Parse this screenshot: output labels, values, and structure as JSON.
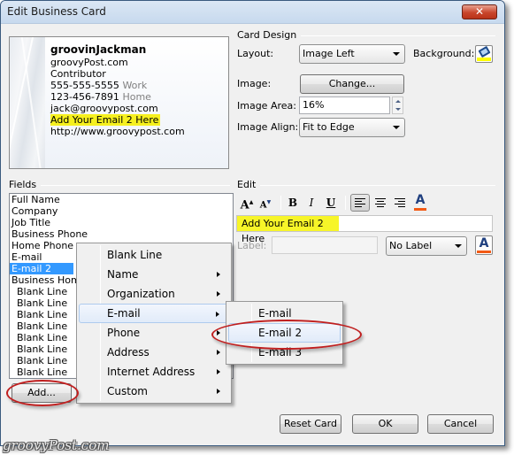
{
  "window": {
    "title": "Edit Business Card",
    "close_glyph": "✕"
  },
  "card_preview": {
    "name": "groovinJackman",
    "company": "groovyPost.com",
    "job_title": "Contributor",
    "work_phone": "555-555-5555",
    "work_label": "Work",
    "home_phone": "123-456-7891",
    "home_label": "Home",
    "email": "jack@groovypost.com",
    "email2": "Add Your Email 2 Here",
    "web": "http://www.groovypost.com"
  },
  "card_design": {
    "header": "Card Design",
    "layout_label": "Layout:",
    "layout_value": "Image Left",
    "background_label": "Background:",
    "image_label": "Image:",
    "change_button": "Change...",
    "image_area_label": "Image Area:",
    "image_area_value": "16%",
    "image_align_label": "Image Align:",
    "image_align_value": "Fit to Edge"
  },
  "fields": {
    "header": "Fields",
    "items": [
      {
        "label": "Full Name",
        "indent": false,
        "selected": false
      },
      {
        "label": "Company",
        "indent": false,
        "selected": false
      },
      {
        "label": "Job Title",
        "indent": false,
        "selected": false
      },
      {
        "label": "Business Phone",
        "indent": false,
        "selected": false
      },
      {
        "label": "Home Phone",
        "indent": false,
        "selected": false
      },
      {
        "label": "E-mail",
        "indent": false,
        "selected": false
      },
      {
        "label": "E-mail 2",
        "indent": false,
        "selected": true
      },
      {
        "label": "Business Home",
        "indent": false,
        "selected": false
      },
      {
        "label": "Blank Line",
        "indent": true,
        "selected": false
      },
      {
        "label": "Blank Line",
        "indent": true,
        "selected": false
      },
      {
        "label": "Blank Line",
        "indent": true,
        "selected": false
      },
      {
        "label": "Blank Line",
        "indent": true,
        "selected": false
      },
      {
        "label": "Blank Line",
        "indent": true,
        "selected": false
      },
      {
        "label": "Blank Line",
        "indent": true,
        "selected": false
      },
      {
        "label": "Blank Line",
        "indent": true,
        "selected": false
      },
      {
        "label": "Blank Line",
        "indent": true,
        "selected": false
      }
    ],
    "add_button": "Add..."
  },
  "edit": {
    "header": "Edit",
    "toolbar": {
      "grow_font": "A",
      "shrink_font": "A",
      "bold": "B",
      "italic": "I",
      "underline": "U",
      "font_color": "A"
    },
    "field_value": "Add Your Email 2 Here",
    "label_label": "Label:",
    "label_value": "",
    "label_position": "No Label",
    "label_color": "A"
  },
  "add_menu": {
    "items": [
      {
        "label": "Blank Line",
        "submenu": false
      },
      {
        "label": "Name",
        "submenu": true
      },
      {
        "label": "Organization",
        "submenu": true
      },
      {
        "label": "E-mail",
        "submenu": true
      },
      {
        "label": "Phone",
        "submenu": true
      },
      {
        "label": "Address",
        "submenu": true
      },
      {
        "label": "Internet Address",
        "submenu": true
      },
      {
        "label": "Custom",
        "submenu": true
      }
    ],
    "hovered": "E-mail"
  },
  "email_submenu": {
    "items": [
      "E-mail",
      "E-mail 2",
      "E-mail 3"
    ],
    "hovered": "E-mail 2"
  },
  "buttons": {
    "reset": "Reset Card",
    "ok": "OK",
    "cancel": "Cancel"
  },
  "colors": {
    "highlight": "#f6f01e",
    "selection": "#3399ff",
    "annotation": "#c01f1f",
    "font_color_bar": "#f25a15"
  },
  "watermark": "groovyPost.com"
}
